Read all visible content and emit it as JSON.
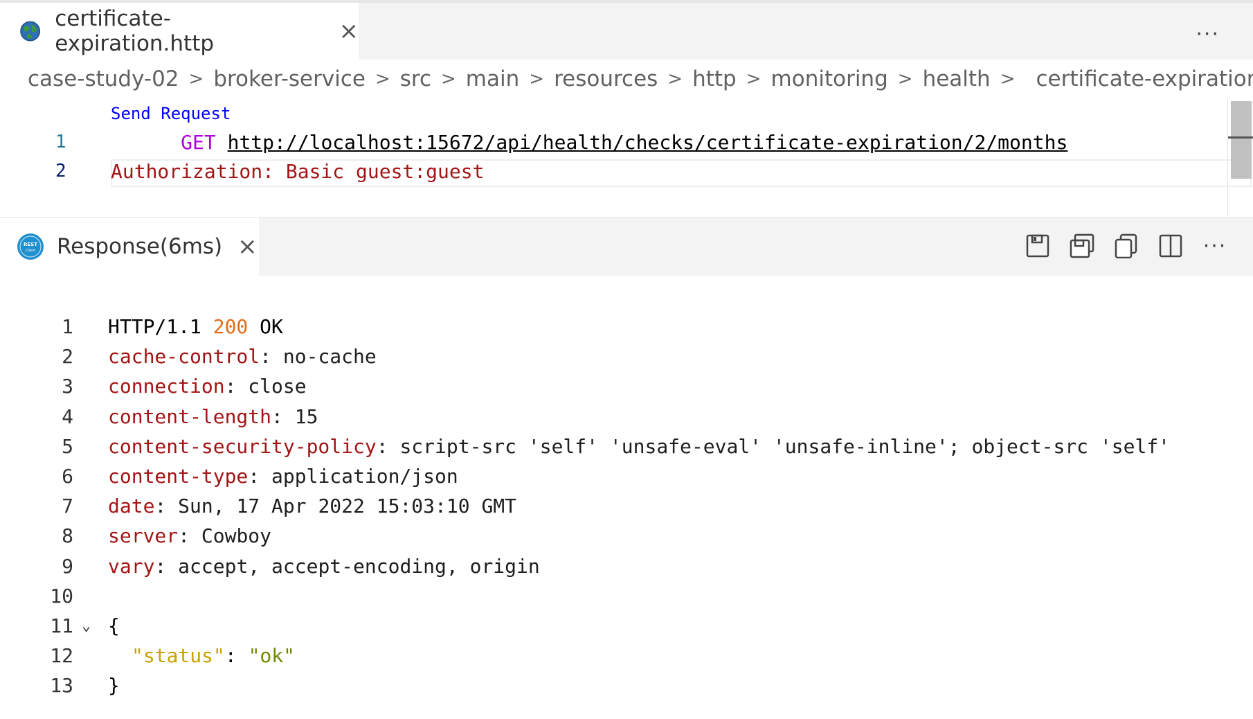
{
  "editor_tab": {
    "title": "certificate-expiration.http",
    "close": "×",
    "more": "···"
  },
  "breadcrumb": [
    "case-study-02",
    "broker-service",
    "src",
    "main",
    "resources",
    "http",
    "monitoring",
    "health",
    "certificate-expiration.http"
  ],
  "request": {
    "send_request": "Send Request",
    "lines": [
      {
        "num": "1",
        "method": "GET",
        "url": "http://localhost:15672/api/health/checks/certificate-expiration/2/months"
      },
      {
        "num": "2",
        "text": "Authorization: Basic guest:guest"
      }
    ]
  },
  "response_tab": {
    "title": "Response(6ms)",
    "close": "×",
    "more": "···"
  },
  "response": {
    "status_line": {
      "num": "1",
      "proto": "HTTP/1.1 ",
      "code": "200",
      "text": " OK"
    },
    "headers": [
      {
        "num": "2",
        "key": "cache-control",
        "value": ": no-cache"
      },
      {
        "num": "3",
        "key": "connection",
        "value": ": close"
      },
      {
        "num": "4",
        "key": "content-length",
        "value": ": 15"
      },
      {
        "num": "5",
        "key": "content-security-policy",
        "value": ": script-src 'self' 'unsafe-eval' 'unsafe-inline'; object-src 'self'"
      },
      {
        "num": "6",
        "key": "content-type",
        "value": ": application/json"
      },
      {
        "num": "7",
        "key": "date",
        "value": ": Sun, 17 Apr 2022 15:03:10 GMT"
      },
      {
        "num": "8",
        "key": "server",
        "value": ": Cowboy"
      },
      {
        "num": "9",
        "key": "vary",
        "value": ": accept, accept-encoding, origin"
      }
    ],
    "blank_num": "10",
    "json_open": {
      "num": "11",
      "text": "{"
    },
    "json_pair": {
      "num": "12",
      "key": "\"status\"",
      "colon": ": ",
      "value": "\"ok\""
    },
    "json_close": {
      "num": "13",
      "text": "}"
    }
  },
  "colors": {
    "accent_blue": "#0000ff",
    "keyword": "#af00db",
    "header_key": "#a31515",
    "status_code": "#e06c1a"
  }
}
